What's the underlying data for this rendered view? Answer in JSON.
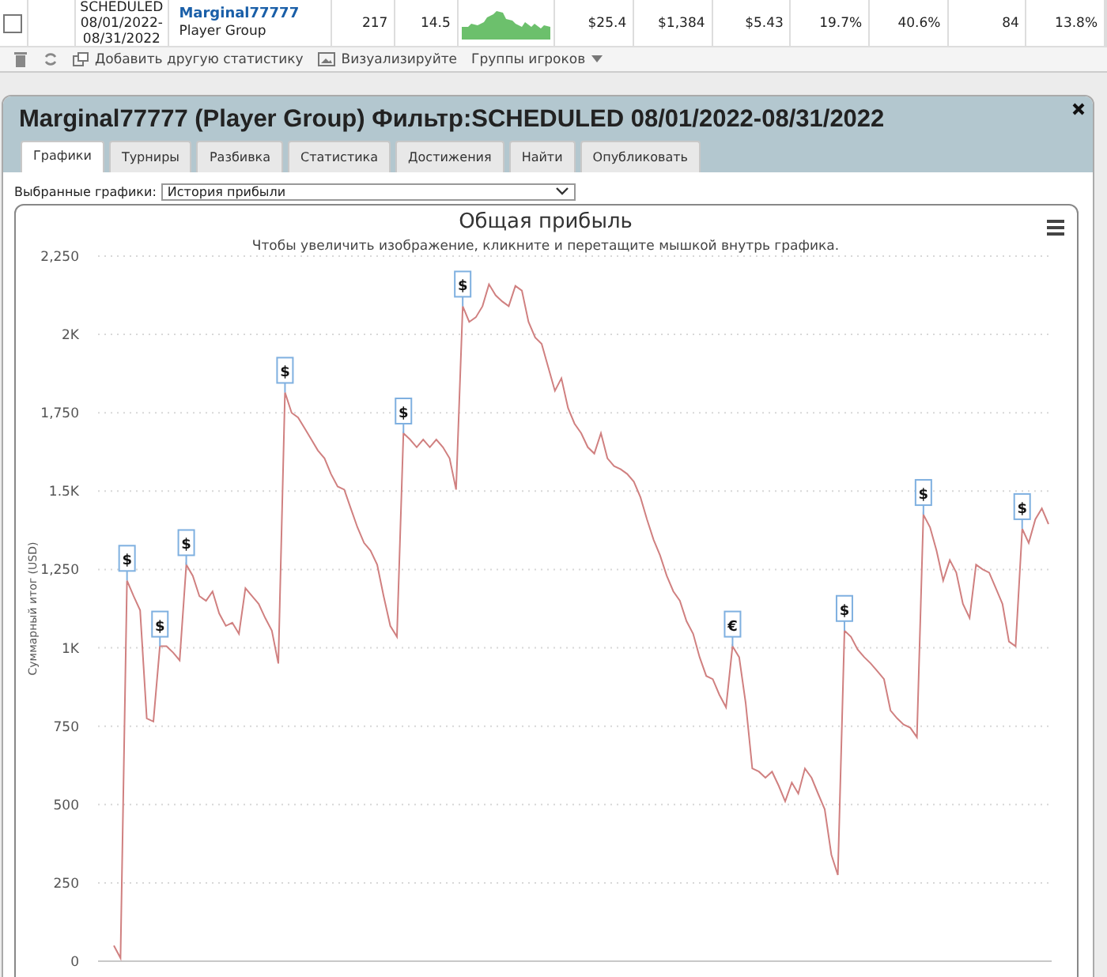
{
  "stats_row": {
    "checked": false,
    "filter": "SCHEDULED 08/01/2022-08/31/2022",
    "player": "Marginal77777",
    "group": "Player Group",
    "cells": [
      "217",
      "14.5"
    ],
    "cells_after": [
      "$25.4",
      "$1,384",
      "$5.43",
      "19.7%",
      "40.6%",
      "84",
      "13.8%"
    ]
  },
  "toolbar": {
    "add_stat": "Добавить другую статистику",
    "visualize": "Визуализируйте",
    "groups": "Группы игроков"
  },
  "dialog": {
    "title": "Marginal77777 (Player Group) Фильтр:SCHEDULED 08/01/2022-08/31/2022",
    "tabs": [
      {
        "label": "Графики",
        "selected": true
      },
      {
        "label": "Турниры",
        "selected": false
      },
      {
        "label": "Разбивка",
        "selected": false
      },
      {
        "label": "Статистика",
        "selected": false
      },
      {
        "label": "Достижения",
        "selected": false
      },
      {
        "label": "Найти",
        "selected": false
      },
      {
        "label": "Опубликовать",
        "selected": false
      }
    ],
    "chart_select": {
      "label": "Выбранные графики:",
      "value": "История прибыли"
    },
    "chart": {
      "subtitle": "Чтобы увеличить изображение, кликните и перетащите мышкой внутрь графика.",
      "chart_data": {
        "type": "line",
        "title": "Общая прибыль",
        "ylabel": "Суммарный итог (USD)",
        "ylim": [
          0,
          2250
        ],
        "yticks": [
          0,
          250,
          500,
          750,
          {
            "value": 1000,
            "label": "1K"
          },
          {
            "value": 1250,
            "label": "1,250"
          },
          {
            "value": 1500,
            "label": "1.5K"
          },
          {
            "value": 1750,
            "label": "1,750"
          },
          {
            "value": 2000,
            "label": "2K"
          },
          {
            "value": 2250,
            "label": "2,250"
          }
        ],
        "grid": true,
        "series": [
          {
            "color": "#d08080",
            "values": [
              50,
              10,
              1215,
              1165,
              1120,
              775,
              765,
              1005,
              1005,
              985,
              960,
              1265,
              1230,
              1165,
              1150,
              1180,
              1110,
              1070,
              1080,
              1045,
              1190,
              1165,
              1140,
              1095,
              1055,
              950,
              1815,
              1750,
              1735,
              1700,
              1665,
              1630,
              1605,
              1555,
              1515,
              1505,
              1445,
              1385,
              1335,
              1310,
              1265,
              1165,
              1070,
              1035,
              1685,
              1665,
              1640,
              1665,
              1640,
              1665,
              1640,
              1605,
              1505,
              2090,
              2040,
              2055,
              2090,
              2160,
              2125,
              2105,
              2090,
              2155,
              2140,
              2040,
              1990,
              1970,
              1895,
              1820,
              1860,
              1765,
              1715,
              1685,
              1640,
              1620,
              1685,
              1605,
              1580,
              1570,
              1555,
              1530,
              1480,
              1410,
              1345,
              1295,
              1230,
              1180,
              1150,
              1085,
              1045,
              970,
              910,
              900,
              850,
              810,
              1005,
              970,
              825,
              615,
              605,
              585,
              605,
              560,
              510,
              570,
              535,
              615,
              585,
              535,
              485,
              340,
              275,
              1055,
              1035,
              995,
              970,
              950,
              925,
              900,
              800,
              775,
              755,
              745,
              715,
              1425,
              1385,
              1310,
              1215,
              1280,
              1240,
              1140,
              1095,
              1265,
              1250,
              1240,
              1190,
              1140,
              1020,
              1005,
              1380,
              1335,
              1410,
              1445,
              1395
            ]
          }
        ],
        "annotations": [
          {
            "text": "$",
            "y": 1215
          },
          {
            "text": "$",
            "y": 1005
          },
          {
            "text": "$",
            "y": 1265
          },
          {
            "text": "$",
            "y": 1815
          },
          {
            "text": "$",
            "y": 1685
          },
          {
            "text": "$",
            "y": 2090
          },
          {
            "text": "€",
            "y": 1005
          },
          {
            "text": "$",
            "y": 1055
          },
          {
            "text": "$",
            "y": 1425
          },
          {
            "text": "$",
            "y": 1380
          }
        ]
      }
    }
  }
}
